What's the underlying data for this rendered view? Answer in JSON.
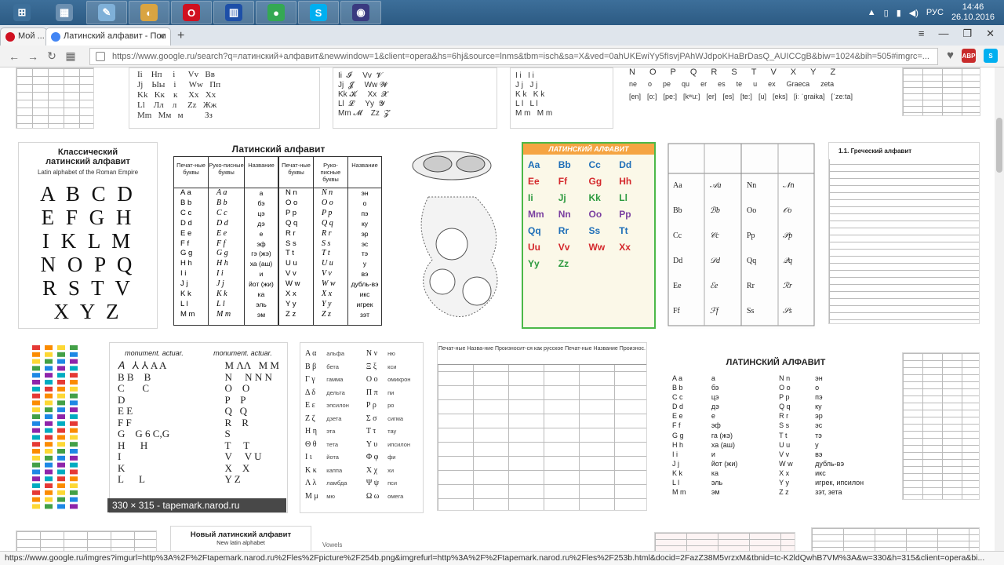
{
  "taskbar": {
    "apps": [
      {
        "name": "start-button",
        "symbol": "⊞",
        "color": "#3d6f9a"
      },
      {
        "name": "calculator",
        "symbol": "▦",
        "color": "#6b8fb0"
      },
      {
        "name": "notepad",
        "symbol": "✎",
        "color": "#7fb0d8"
      },
      {
        "name": "paint",
        "symbol": "◐",
        "color": "#d9a441"
      },
      {
        "name": "opera",
        "symbol": "O",
        "color": "#d01020"
      },
      {
        "name": "network",
        "symbol": "▥",
        "color": "#1d4fa8"
      },
      {
        "name": "chrome",
        "symbol": "●",
        "color": "#34a853"
      },
      {
        "name": "skype",
        "symbol": "S",
        "color": "#00aff0"
      },
      {
        "name": "media",
        "symbol": "◉",
        "color": "#3a3a80"
      }
    ],
    "lang": "РУС",
    "time": "14:46",
    "date": "26.10.2016"
  },
  "tabs": [
    {
      "label": "Мой ..."
    },
    {
      "label": "Латинский алфавит - Пои"
    }
  ],
  "omnibox": {
    "url": "https://www.google.ru/search?q=латинский+алфавит&newwindow=1&client=opera&hs=6hj&source=lnms&tbm=isch&sa=X&ved=0ahUKEwiYy5fIsvjPAhWJdpoKHaBrDasQ_AUICCgB&biw=1024&bih=505#imgrc=..."
  },
  "extensions": [
    {
      "label": "ABP",
      "color": "#c82b2b"
    },
    {
      "label": "S",
      "color": "#00aff0"
    }
  ],
  "thumbs": {
    "classic": {
      "title1": "Классический",
      "title2": "латинский алфавит",
      "subtitle": "Latin alphabet of the Roman Empire",
      "rows": [
        "A B C D",
        "E F G H",
        "I K L M",
        "N O P Q",
        "R S T V",
        "X Y Z"
      ]
    },
    "table1": {
      "title": "Латинский алфавит",
      "headers": [
        "Печат-ные буквы",
        "Руко-писные буквы",
        "Название",
        "Печат-ные буквы",
        "Руко-писные буквы",
        "Название"
      ],
      "left": [
        "A a",
        "B b",
        "C c",
        "D d",
        "E e",
        "F f",
        "G g",
        "H h",
        "I i",
        "J j",
        "K k",
        "L l",
        "M m"
      ],
      "left_names": [
        "а",
        "бэ",
        "цэ",
        "дэ",
        "е",
        "эф",
        "гэ (жэ)",
        "ха (аш)",
        "и",
        "йот (жи)",
        "ка",
        "эль",
        "эм"
      ],
      "right": [
        "N n",
        "O o",
        "P p",
        "Q q",
        "R r",
        "S s",
        "T t",
        "U u",
        "V v",
        "W w",
        "X x",
        "Y y",
        "Z z"
      ],
      "right_names": [
        "эн",
        "о",
        "пэ",
        "ку",
        "эр",
        "эс",
        "тэ",
        "у",
        "вэ",
        "дубль-вэ",
        "икс",
        "игрек",
        "зэт"
      ]
    },
    "colorful": {
      "title": "ЛАТИНСКИЙ АЛФАВИТ",
      "pairs": [
        "Aa",
        "Bb",
        "Cc",
        "Dd",
        "Ee",
        "Ff",
        "Gg",
        "Hh",
        "Ii",
        "Jj",
        "Kk",
        "Ll",
        "Mm",
        "Nn",
        "Oo",
        "Pp",
        "Qq",
        "Rr",
        "Ss",
        "Tt",
        "Uu",
        "Vv",
        "Ww",
        "Xx",
        "Yy",
        "Zz"
      ]
    },
    "greek": {
      "title": "1.1. Греческий алфавит"
    },
    "greek_table": {
      "left": [
        "Α α",
        "Β β",
        "Γ γ",
        "Δ δ",
        "Ε ε",
        "Ζ ζ",
        "Η η",
        "Θ θ",
        "Ι ι",
        "Κ κ",
        "Λ λ",
        "Μ μ"
      ],
      "left_names": [
        "альфа",
        "бета",
        "гамма",
        "дельта",
        "эпсилон",
        "дзета",
        "эта",
        "тета",
        "йота",
        "каппа",
        "ламбда",
        "мю"
      ],
      "right": [
        "Ν ν",
        "Ξ ξ",
        "Ο ο",
        "Π π",
        "Ρ ρ",
        "Σ σ",
        "Τ τ",
        "Υ υ",
        "Φ φ",
        "Χ χ",
        "Ψ ψ",
        "Ω ω"
      ],
      "right_names": [
        "ню",
        "кси",
        "омикрон",
        "пи",
        "ро",
        "сигма",
        "тау",
        "ипсилон",
        "фи",
        "хи",
        "пси",
        "омега"
      ]
    },
    "latin2": {
      "title": "ЛАТИНСКИЙ АЛФАВИТ",
      "rows": [
        [
          "A a",
          "а",
          "N n",
          "эн"
        ],
        [
          "B b",
          "бэ",
          "O o",
          "о"
        ],
        [
          "C c",
          "цэ",
          "P p",
          "пэ"
        ],
        [
          "D d",
          "дэ",
          "Q q",
          "ку"
        ],
        [
          "E e",
          "е",
          "R r",
          "эр"
        ],
        [
          "F f",
          "эф",
          "S s",
          "эс"
        ],
        [
          "G g",
          "га (жэ)",
          "T t",
          "тэ"
        ],
        [
          "H h",
          "ха (аш)",
          "U u",
          "у"
        ],
        [
          "I i",
          "и",
          "V v",
          "вэ"
        ],
        [
          "J j",
          "йот (жи)",
          "W w",
          "дубль-вэ"
        ],
        [
          "K k",
          "ка",
          "X x",
          "икс"
        ],
        [
          "L l",
          "эль",
          "Y y",
          "игрек, ипсилон"
        ],
        [
          "M m",
          "эм",
          "Z z",
          "зэт, зета"
        ]
      ]
    },
    "monument": {
      "head1": "monument. actuar.",
      "head2": "monument. actuar."
    },
    "new_latin": {
      "title": "Новый латинский алфавит",
      "subtitle": "New latin alphabet"
    },
    "top_phonetic": {
      "row1": [
        "N",
        "O",
        "P",
        "Q",
        "R",
        "S",
        "T",
        "V",
        "X",
        "Y",
        "Z"
      ],
      "row2": [
        "ne",
        "o",
        "pe",
        "qu",
        "er",
        "es",
        "te",
        "u",
        "ex",
        "Graeca",
        "zeta"
      ],
      "row3": [
        "[en]",
        "[o:]",
        "[pe:]",
        "[kʷu:]",
        "[er]",
        "[es]",
        "[te:]",
        "[u]",
        "[eks]",
        "[iː ˈgraika]",
        "[ˈzeːta]"
      ]
    }
  },
  "tooltip": "330 × 315 - tapemark.narod.ru",
  "vowels_label": "Vowels",
  "status": "https://www.google.ru/imgres?imgurl=http%3A%2F%2Ftapemark.narod.ru%2Fles%2Fpicture%2F254b.png&imgrefurl=http%3A%2F%2Ftapemark.narod.ru%2Fles%2F253b.html&docid=2FazZ38M5vrzxM&tbnid=tc-K2ldQwhB7VM%3A&w=330&h=315&client=opera&bi..."
}
